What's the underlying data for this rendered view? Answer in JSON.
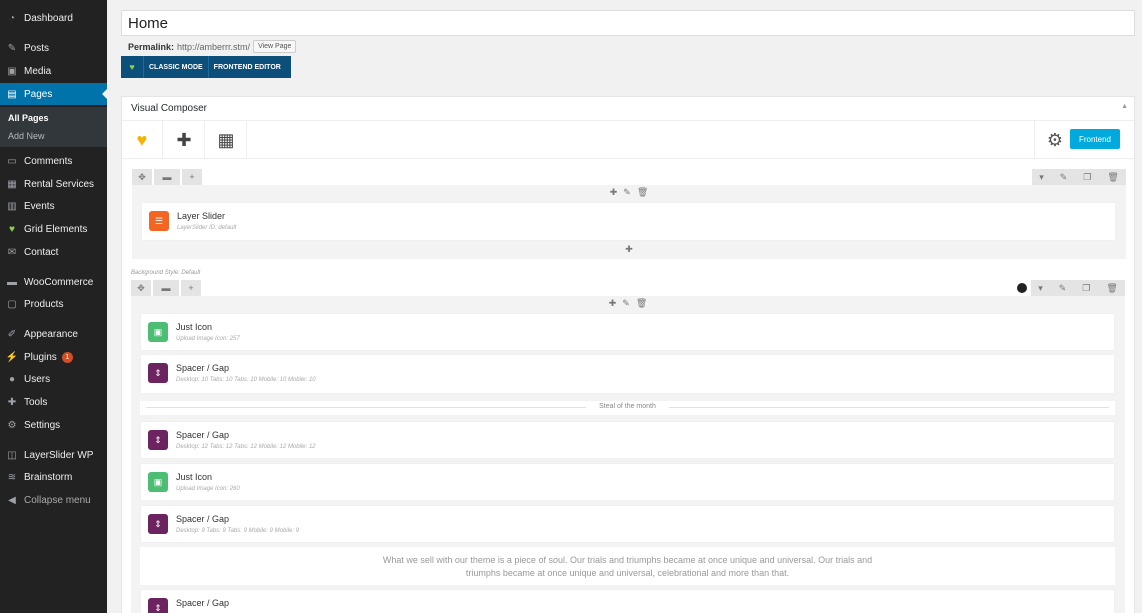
{
  "sidebar": {
    "items": [
      {
        "label": "Dashboard",
        "icon": "dashboard-icon"
      },
      {
        "label": "Posts",
        "icon": "pin-icon"
      },
      {
        "label": "Media",
        "icon": "media-icon"
      },
      {
        "label": "Pages",
        "icon": "pages-icon"
      },
      {
        "label": "Comments",
        "icon": "comment-icon"
      },
      {
        "label": "Rental Services",
        "icon": "rental-icon"
      },
      {
        "label": "Events",
        "icon": "calendar-icon"
      },
      {
        "label": "Grid Elements",
        "icon": "grid-icon"
      },
      {
        "label": "Contact",
        "icon": "mail-icon"
      },
      {
        "label": "WooCommerce",
        "icon": "woo-icon"
      },
      {
        "label": "Products",
        "icon": "products-icon"
      },
      {
        "label": "Appearance",
        "icon": "brush-icon"
      },
      {
        "label": "Plugins",
        "icon": "plugin-icon",
        "badge": "1"
      },
      {
        "label": "Users",
        "icon": "user-icon"
      },
      {
        "label": "Tools",
        "icon": "wrench-icon"
      },
      {
        "label": "Settings",
        "icon": "settings-icon"
      },
      {
        "label": "LayerSlider WP",
        "icon": "layerslider-icon"
      },
      {
        "label": "Brainstorm",
        "icon": "brainstorm-icon"
      },
      {
        "label": "Collapse menu",
        "icon": "collapse-icon"
      }
    ],
    "submenu": [
      "All Pages",
      "Add New"
    ]
  },
  "editor": {
    "title": "Home",
    "permalink_label": "Permalink:",
    "permalink_url": "http://amberrr.stm/",
    "view_page": "View Page",
    "classic_mode": "CLASSIC MODE",
    "frontend_editor": "FRONTEND EDITOR"
  },
  "vc": {
    "title": "Visual Composer",
    "frontend_button": "Frontend",
    "row1": {
      "element": {
        "title": "Layer Slider",
        "sub": "LayerSlider ID: default"
      }
    },
    "bg_style": "Background Style: Default",
    "row2": {
      "elements": [
        {
          "title": "Just Icon",
          "sub": "Upload Image Icon: 257"
        },
        {
          "title": "Spacer / Gap",
          "sub": "Desktop: 10   Tabs: 10   Tabs: 10   Mobile: 10   Mobile: 10"
        },
        {
          "title": "Spacer / Gap",
          "sub": "Desktop: 12   Tabs: 12   Tabs: 12   Mobile: 12   Mobile: 12"
        },
        {
          "title": "Just Icon",
          "sub": "Upload Image Icon: 260"
        },
        {
          "title": "Spacer / Gap",
          "sub": "Desktop: 9   Tabs: 9   Tabs: 9   Mobile: 9   Mobile: 9"
        },
        {
          "title": "Spacer / Gap",
          "sub": ""
        }
      ],
      "separator": "Steal of the month",
      "text_block": "What we sell with our theme is a piece of soul. Our trials and triumphs became at once unique and universal. Our trials and triumphs became at once unique and universal, celebrational and more than that."
    }
  },
  "colors": {
    "sidebar_bg": "#222222",
    "active_blue": "#0073aa",
    "frontend_btn": "#00aadc",
    "layer_slider_icon": "#f26522",
    "just_icon": "#4dbd74",
    "spacer_icon": "#6b2460"
  }
}
